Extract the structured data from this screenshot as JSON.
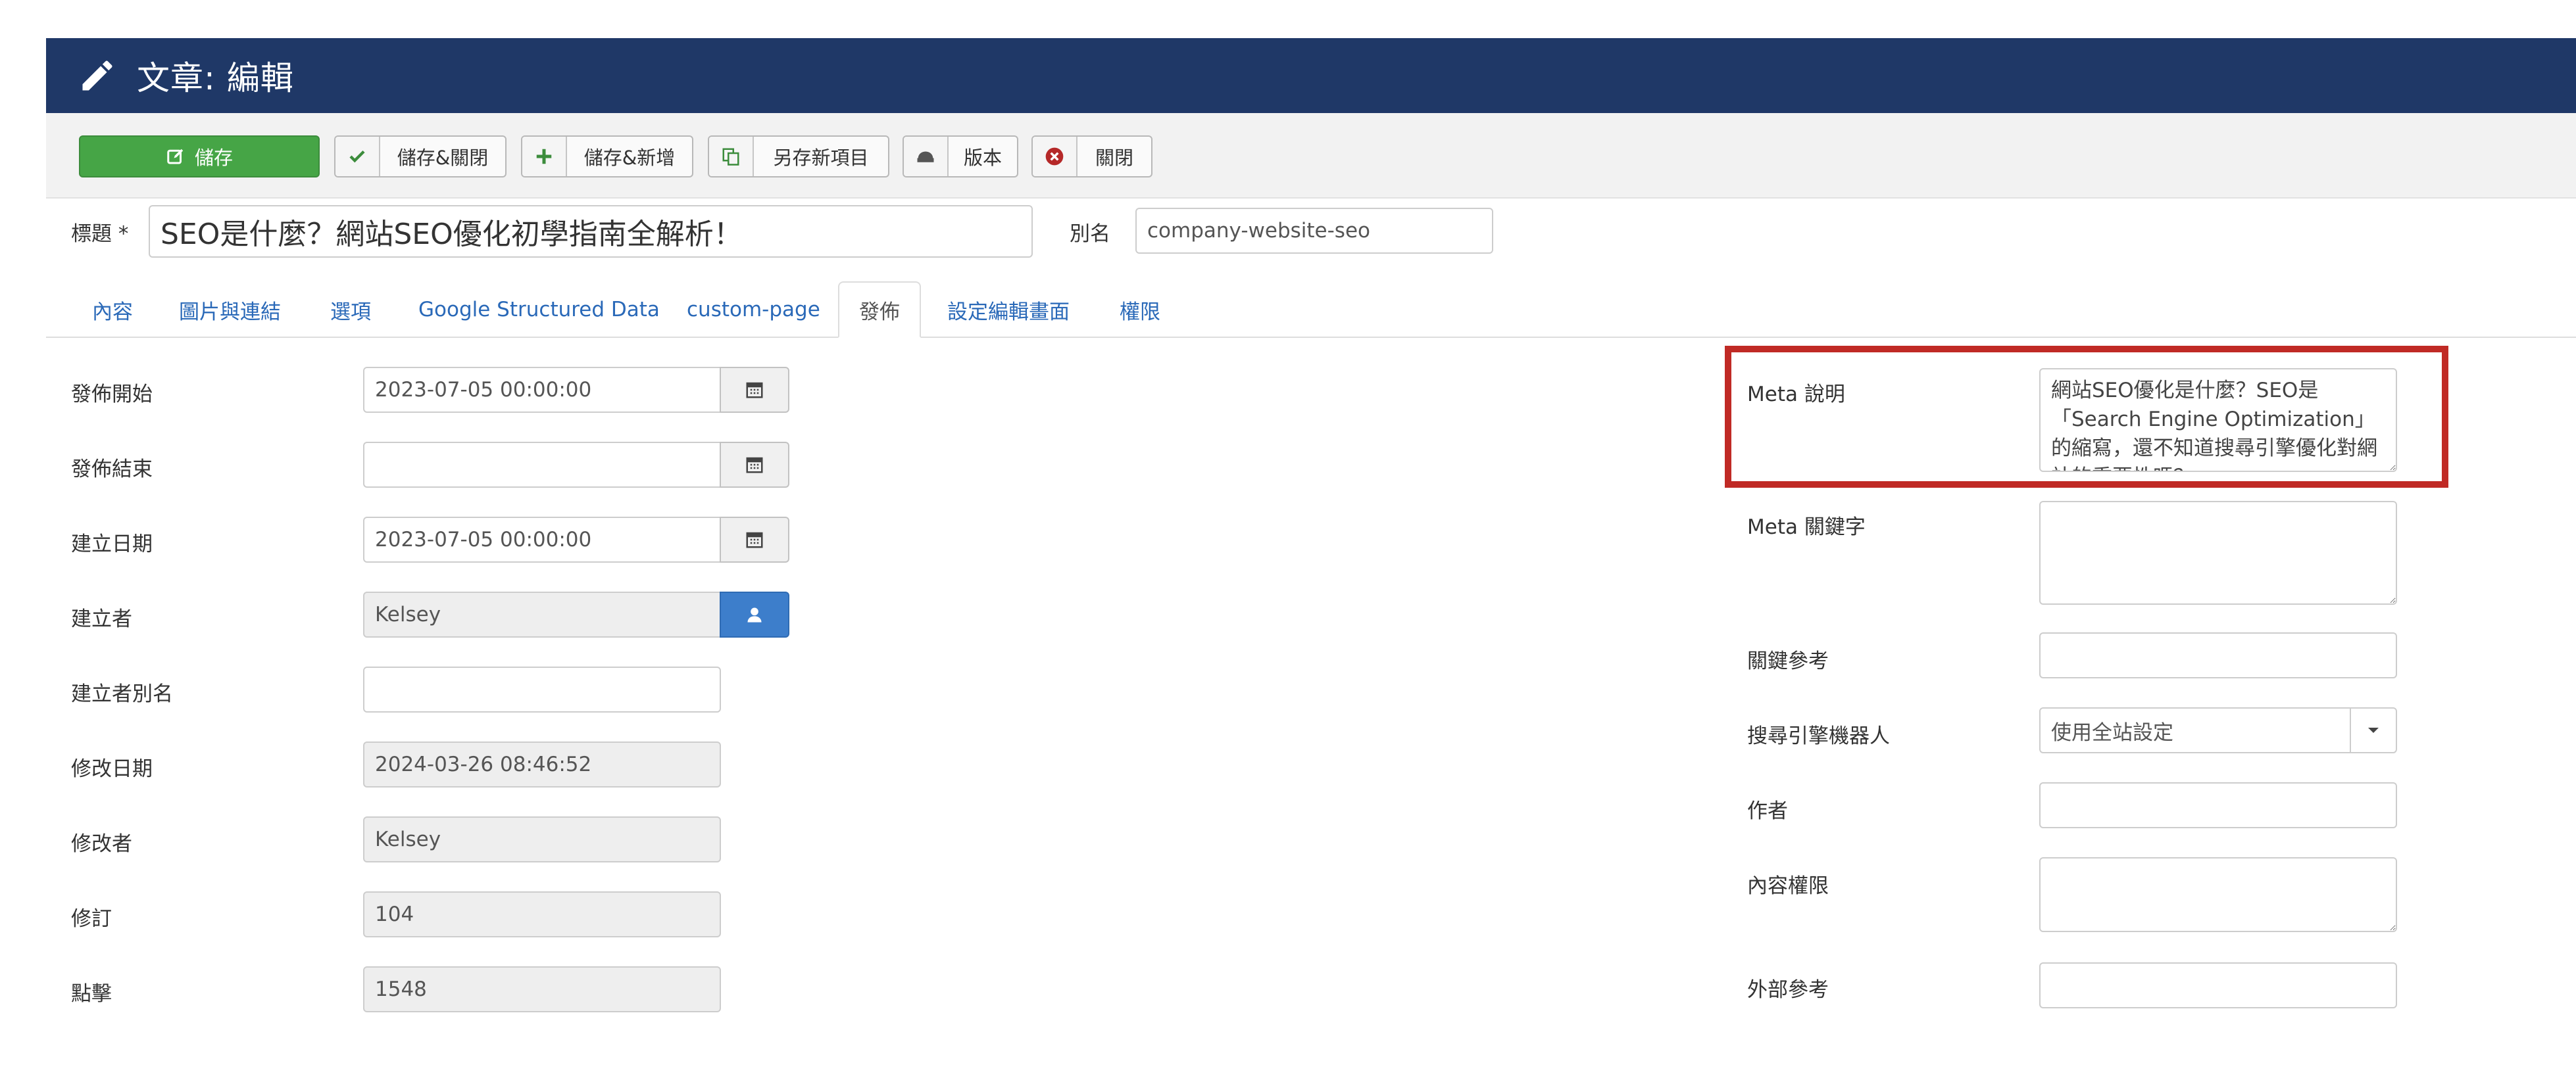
{
  "header": {
    "title": "文章: 編輯",
    "icon": "pencil-icon"
  },
  "toolbar": {
    "save": "儲存",
    "save_close": "儲存&關閉",
    "save_new": "儲存&新增",
    "save_copy": "另存新項目",
    "versions": "版本",
    "close": "關閉"
  },
  "title_row": {
    "title_label": "標題 *",
    "title_value": "SEO是什麼？網站SEO優化初學指南全解析！",
    "alias_label": "別名",
    "alias_value": "company-website-seo"
  },
  "tabs": [
    {
      "label": "內容"
    },
    {
      "label": "圖片與連結"
    },
    {
      "label": "選項"
    },
    {
      "label": "Google Structured Data"
    },
    {
      "label": "custom-page"
    },
    {
      "label": "發佈",
      "active": true
    },
    {
      "label": "設定編輯畫面"
    },
    {
      "label": "權限"
    }
  ],
  "publishing": {
    "publish_up_label": "發佈開始",
    "publish_up_value": "2023-07-05 00:00:00",
    "publish_down_label": "發佈結束",
    "publish_down_value": "",
    "created_label": "建立日期",
    "created_value": "2023-07-05 00:00:00",
    "created_by_label": "建立者",
    "created_by_value": "Kelsey",
    "created_by_alias_label": "建立者別名",
    "created_by_alias_value": "",
    "modified_label": "修改日期",
    "modified_value": "2024-03-26 08:46:52",
    "modified_by_label": "修改者",
    "modified_by_value": "Kelsey",
    "version_label": "修訂",
    "version_value": "104",
    "hits_label": "點擊",
    "hits_value": "1548"
  },
  "meta": {
    "description_label": "Meta 說明",
    "description_value": "網站SEO優化是什麼？SEO是「Search Engine Optimization」的縮寫，還不知道搜尋引擎優化對網站的重要性嗎？",
    "keywords_label": "Meta 關鍵字",
    "keywords_value": "",
    "key_reference_label": "關鍵參考",
    "key_reference_value": "",
    "robots_label": "搜尋引擎機器人",
    "robots_value": "使用全站設定",
    "author_label": "作者",
    "author_value": "",
    "rights_label": "內容權限",
    "rights_value": "",
    "xreference_label": "外部參考",
    "xreference_value": ""
  },
  "colors": {
    "header_bg": "#1f3867",
    "save_green": "#46a546",
    "link_blue": "#2a69b8",
    "highlight_red": "#c02a25",
    "user_button_blue": "#3d7ecb"
  }
}
